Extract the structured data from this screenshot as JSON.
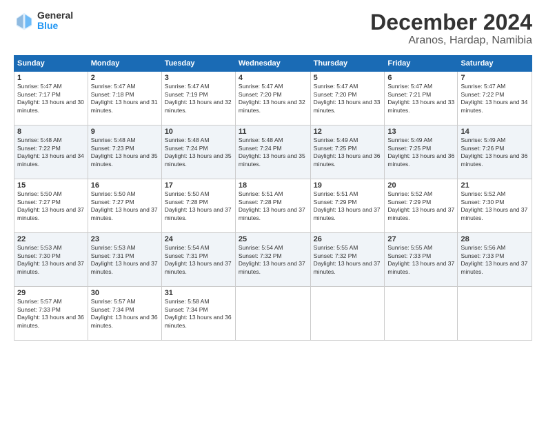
{
  "header": {
    "logo_general": "General",
    "logo_blue": "Blue",
    "month_title": "December 2024",
    "location": "Aranos, Hardap, Namibia"
  },
  "calendar": {
    "days_of_week": [
      "Sunday",
      "Monday",
      "Tuesday",
      "Wednesday",
      "Thursday",
      "Friday",
      "Saturday"
    ],
    "weeks": [
      [
        null,
        {
          "day": "2",
          "sunrise": "Sunrise: 5:47 AM",
          "sunset": "Sunset: 7:18 PM",
          "daylight": "Daylight: 13 hours and 31 minutes."
        },
        {
          "day": "3",
          "sunrise": "Sunrise: 5:47 AM",
          "sunset": "Sunset: 7:19 PM",
          "daylight": "Daylight: 13 hours and 32 minutes."
        },
        {
          "day": "4",
          "sunrise": "Sunrise: 5:47 AM",
          "sunset": "Sunset: 7:20 PM",
          "daylight": "Daylight: 13 hours and 32 minutes."
        },
        {
          "day": "5",
          "sunrise": "Sunrise: 5:47 AM",
          "sunset": "Sunset: 7:20 PM",
          "daylight": "Daylight: 13 hours and 33 minutes."
        },
        {
          "day": "6",
          "sunrise": "Sunrise: 5:47 AM",
          "sunset": "Sunset: 7:21 PM",
          "daylight": "Daylight: 13 hours and 33 minutes."
        },
        {
          "day": "7",
          "sunrise": "Sunrise: 5:47 AM",
          "sunset": "Sunset: 7:22 PM",
          "daylight": "Daylight: 13 hours and 34 minutes."
        }
      ],
      [
        {
          "day": "1",
          "sunrise": "Sunrise: 5:47 AM",
          "sunset": "Sunset: 7:17 PM",
          "daylight": "Daylight: 13 hours and 30 minutes."
        },
        null,
        null,
        null,
        null,
        null,
        null
      ],
      [
        {
          "day": "8",
          "sunrise": "Sunrise: 5:48 AM",
          "sunset": "Sunset: 7:22 PM",
          "daylight": "Daylight: 13 hours and 34 minutes."
        },
        {
          "day": "9",
          "sunrise": "Sunrise: 5:48 AM",
          "sunset": "Sunset: 7:23 PM",
          "daylight": "Daylight: 13 hours and 35 minutes."
        },
        {
          "day": "10",
          "sunrise": "Sunrise: 5:48 AM",
          "sunset": "Sunset: 7:24 PM",
          "daylight": "Daylight: 13 hours and 35 minutes."
        },
        {
          "day": "11",
          "sunrise": "Sunrise: 5:48 AM",
          "sunset": "Sunset: 7:24 PM",
          "daylight": "Daylight: 13 hours and 35 minutes."
        },
        {
          "day": "12",
          "sunrise": "Sunrise: 5:49 AM",
          "sunset": "Sunset: 7:25 PM",
          "daylight": "Daylight: 13 hours and 36 minutes."
        },
        {
          "day": "13",
          "sunrise": "Sunrise: 5:49 AM",
          "sunset": "Sunset: 7:25 PM",
          "daylight": "Daylight: 13 hours and 36 minutes."
        },
        {
          "day": "14",
          "sunrise": "Sunrise: 5:49 AM",
          "sunset": "Sunset: 7:26 PM",
          "daylight": "Daylight: 13 hours and 36 minutes."
        }
      ],
      [
        {
          "day": "15",
          "sunrise": "Sunrise: 5:50 AM",
          "sunset": "Sunset: 7:27 PM",
          "daylight": "Daylight: 13 hours and 37 minutes."
        },
        {
          "day": "16",
          "sunrise": "Sunrise: 5:50 AM",
          "sunset": "Sunset: 7:27 PM",
          "daylight": "Daylight: 13 hours and 37 minutes."
        },
        {
          "day": "17",
          "sunrise": "Sunrise: 5:50 AM",
          "sunset": "Sunset: 7:28 PM",
          "daylight": "Daylight: 13 hours and 37 minutes."
        },
        {
          "day": "18",
          "sunrise": "Sunrise: 5:51 AM",
          "sunset": "Sunset: 7:28 PM",
          "daylight": "Daylight: 13 hours and 37 minutes."
        },
        {
          "day": "19",
          "sunrise": "Sunrise: 5:51 AM",
          "sunset": "Sunset: 7:29 PM",
          "daylight": "Daylight: 13 hours and 37 minutes."
        },
        {
          "day": "20",
          "sunrise": "Sunrise: 5:52 AM",
          "sunset": "Sunset: 7:29 PM",
          "daylight": "Daylight: 13 hours and 37 minutes."
        },
        {
          "day": "21",
          "sunrise": "Sunrise: 5:52 AM",
          "sunset": "Sunset: 7:30 PM",
          "daylight": "Daylight: 13 hours and 37 minutes."
        }
      ],
      [
        {
          "day": "22",
          "sunrise": "Sunrise: 5:53 AM",
          "sunset": "Sunset: 7:30 PM",
          "daylight": "Daylight: 13 hours and 37 minutes."
        },
        {
          "day": "23",
          "sunrise": "Sunrise: 5:53 AM",
          "sunset": "Sunset: 7:31 PM",
          "daylight": "Daylight: 13 hours and 37 minutes."
        },
        {
          "day": "24",
          "sunrise": "Sunrise: 5:54 AM",
          "sunset": "Sunset: 7:31 PM",
          "daylight": "Daylight: 13 hours and 37 minutes."
        },
        {
          "day": "25",
          "sunrise": "Sunrise: 5:54 AM",
          "sunset": "Sunset: 7:32 PM",
          "daylight": "Daylight: 13 hours and 37 minutes."
        },
        {
          "day": "26",
          "sunrise": "Sunrise: 5:55 AM",
          "sunset": "Sunset: 7:32 PM",
          "daylight": "Daylight: 13 hours and 37 minutes."
        },
        {
          "day": "27",
          "sunrise": "Sunrise: 5:55 AM",
          "sunset": "Sunset: 7:33 PM",
          "daylight": "Daylight: 13 hours and 37 minutes."
        },
        {
          "day": "28",
          "sunrise": "Sunrise: 5:56 AM",
          "sunset": "Sunset: 7:33 PM",
          "daylight": "Daylight: 13 hours and 37 minutes."
        }
      ],
      [
        {
          "day": "29",
          "sunrise": "Sunrise: 5:57 AM",
          "sunset": "Sunset: 7:33 PM",
          "daylight": "Daylight: 13 hours and 36 minutes."
        },
        {
          "day": "30",
          "sunrise": "Sunrise: 5:57 AM",
          "sunset": "Sunset: 7:34 PM",
          "daylight": "Daylight: 13 hours and 36 minutes."
        },
        {
          "day": "31",
          "sunrise": "Sunrise: 5:58 AM",
          "sunset": "Sunset: 7:34 PM",
          "daylight": "Daylight: 13 hours and 36 minutes."
        },
        null,
        null,
        null,
        null
      ]
    ]
  }
}
